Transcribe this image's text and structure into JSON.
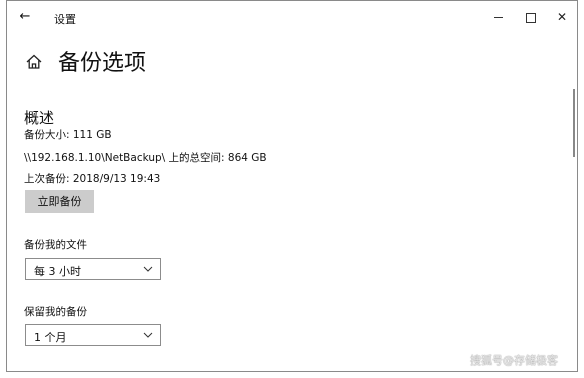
{
  "window": {
    "title": "设置",
    "back_icon": "arrow-left-icon",
    "minimize_icon": "minimize-icon",
    "maximize_icon": "maximize-icon",
    "close_icon": "close-icon",
    "close_glyph": "✕"
  },
  "page": {
    "title": "备份选项",
    "home_icon": "home-icon"
  },
  "overview": {
    "title": "概述",
    "backup_size": "备份大小: 111 GB",
    "total_space": "\\\\192.168.1.10\\NetBackup\\ 上的总空间: 864 GB",
    "last_backup": "上次备份: 2018/9/13 19:43",
    "backup_now_label": "立即备份"
  },
  "backup_frequency": {
    "label": "备份我的文件",
    "value": "每 3 小时"
  },
  "keep_backups": {
    "label": "保留我的备份",
    "value": "1 个月"
  },
  "watermark": "搜狐号@存储极客"
}
